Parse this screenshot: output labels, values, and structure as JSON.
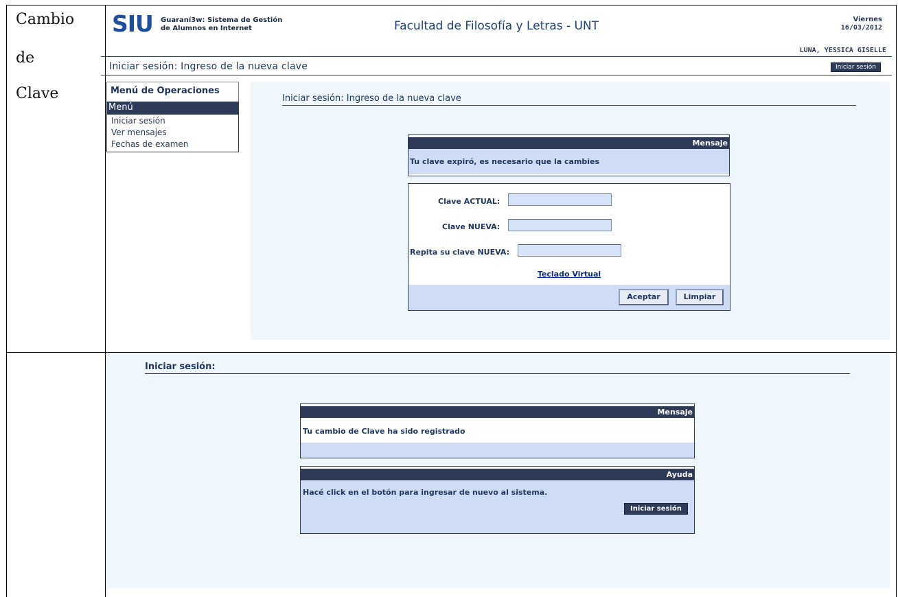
{
  "side_labels": {
    "line1": "Cambio",
    "line2": "de",
    "line3": "Clave"
  },
  "header": {
    "logo_text": "SIU",
    "system_line1": "Guaraní3w: Sistema de Gestión",
    "system_line2": "de Alumnos en Internet",
    "faculty": "Facultad de Filosofía y Letras - UNT",
    "day": "Viernes",
    "date": "16/03/2012",
    "user": "LUNA, YESSICA GISELLE",
    "page_title": "Iniciar sesión: Ingreso de la nueva clave",
    "login_button": "Iniciar sesión"
  },
  "menu": {
    "title": "Menú de Operaciones",
    "selected": "Menú",
    "items": [
      "Iniciar sesión",
      "Ver mensajes",
      "Fechas de examen"
    ]
  },
  "form_panel": {
    "title": "Iniciar sesión: Ingreso de la nueva clave",
    "message_header": "Mensaje",
    "message_text": "Tu clave expiró, es necesario que la cambies",
    "current_label": "Clave ACTUAL:",
    "new_label": "Clave NUEVA:",
    "repeat_label": "Repita su clave NUEVA:",
    "current_value": "",
    "new_value": "",
    "repeat_value": "",
    "virtual_keyboard": "Teclado Virtual",
    "accept_button": "Aceptar",
    "clear_button": "Limpiar"
  },
  "confirm_panel": {
    "title": "Iniciar sesión:",
    "message_header": "Mensaje",
    "message_text": "Tu cambio de Clave ha sido registrado",
    "help_header": "Ayuda",
    "help_text": "Hacé click en el botón para ingresar de nuevo al sistema.",
    "login_button": "Iniciar sesión"
  },
  "colors": {
    "header_navy": "#2d3b59",
    "panel_light_blue": "#cfdcf6",
    "content_bg": "#f0f7fc",
    "logo_blue": "#1f4f9a"
  }
}
